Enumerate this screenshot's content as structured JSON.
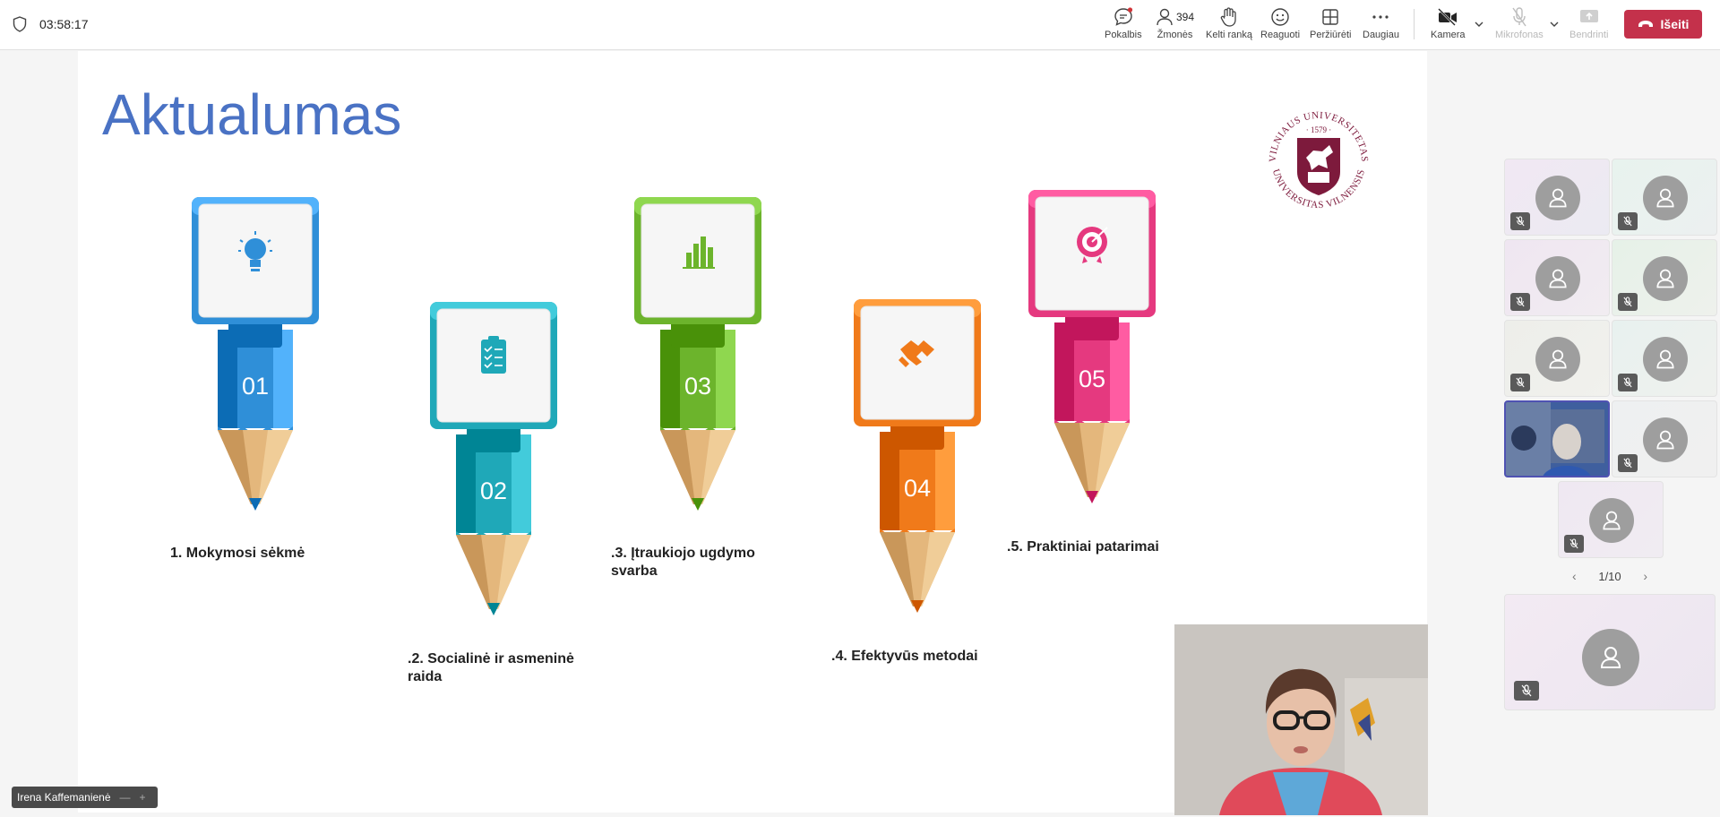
{
  "meeting": {
    "timer": "03:58:17"
  },
  "toolbar": {
    "chat_label": "Pokalbis",
    "people_label": "Žmonės",
    "people_count": "394",
    "raise_hand_label": "Kelti ranką",
    "react_label": "Reaguoti",
    "view_label": "Peržiūrėti",
    "more_label": "Daugiau",
    "camera_label": "Kamera",
    "mic_label": "Mikrofonas",
    "share_label": "Bendrinti",
    "leave_label": "Išeiti",
    "leave_color": "#c4314b"
  },
  "slide": {
    "title": "Aktualumas",
    "title_color": "#4a72c4",
    "logo": {
      "text_top": "VILNIAUS UNIVERSITETAS",
      "text_bottom": "UNIVERSITAS VILNENSIS",
      "year": "1579"
    },
    "pencils": [
      {
        "number": "01",
        "label": "1. Mokymosi sėkmė",
        "color": "#2f8fd8",
        "icon": "lightbulb-icon"
      },
      {
        "number": "02",
        "label": ".2. Socialinė ir asmeninė raida",
        "color": "#1fa8b8",
        "icon": "checklist-icon"
      },
      {
        "number": "03",
        "label": ".3. Įtraukiojo ugdymo svarba",
        "color": "#6cb42c",
        "icon": "bar-chart-icon"
      },
      {
        "number": "04",
        "label": ".4. Efektyvūs metodai",
        "color": "#f07a1a",
        "icon": "handshake-icon"
      },
      {
        "number": "05",
        "label": ".5. Praktiniai patarimai",
        "color": "#e5397f",
        "icon": "target-icon"
      }
    ]
  },
  "participants": {
    "pager": "1/10"
  },
  "footer": {
    "name_tag": "Irena Kaffemanienė"
  }
}
